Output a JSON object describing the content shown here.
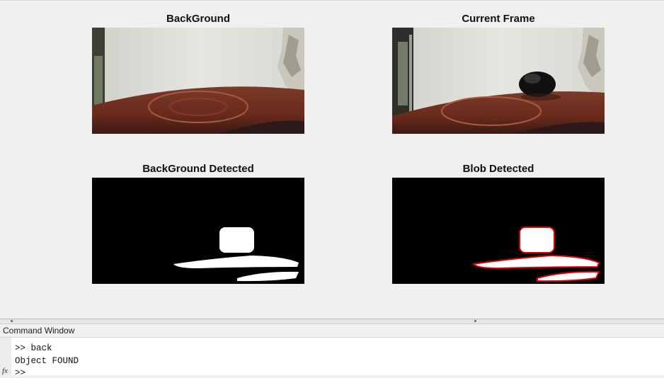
{
  "figure": {
    "panels": [
      {
        "title": "BackGround",
        "image": "background-photo"
      },
      {
        "title": "Current Frame",
        "image": "current-frame-photo"
      },
      {
        "title": "BackGround Detected",
        "image": "binary-mask"
      },
      {
        "title": "Blob Detected",
        "image": "blob-outline-mask"
      }
    ]
  },
  "command_window": {
    "title": "Command Window",
    "fx_icon": "fx-icon",
    "lines": [
      ">> back",
      "Object FOUND",
      ">>"
    ]
  },
  "colors": {
    "figure_bg": "#f0f0f0",
    "blob_outline": "#e00000",
    "table_wood": "#6b2a1c",
    "wall": "#e4e4df"
  }
}
